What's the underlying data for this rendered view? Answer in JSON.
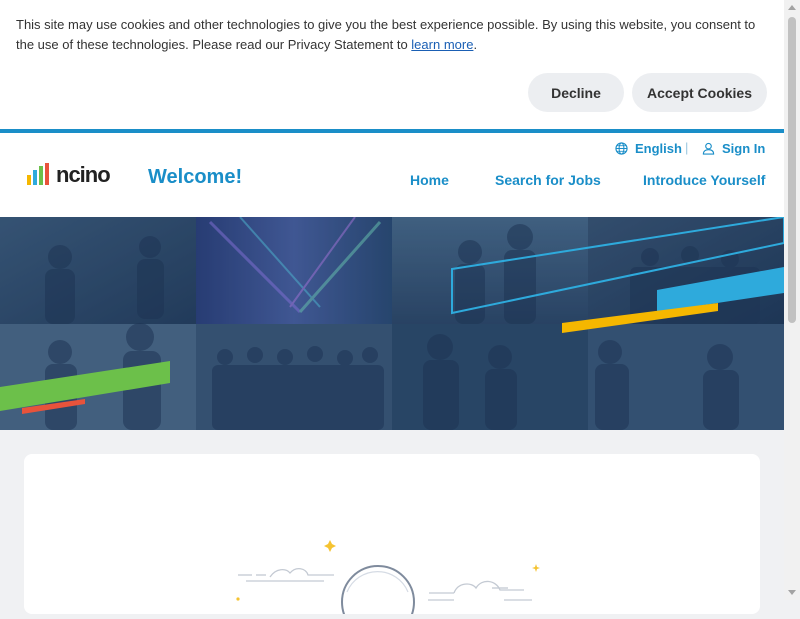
{
  "cookie_banner": {
    "text": "This site may use cookies and other technologies to give you the best experience possible. By using this website, you consent to the use of these technologies. Please read our Privacy Statement to ",
    "link_text": "learn more",
    "text_end": ".",
    "decline_label": "Decline",
    "accept_label": "Accept Cookies"
  },
  "header": {
    "language": "English",
    "separator": "|",
    "sign_in": "Sign In",
    "logo_text": "ncino",
    "welcome": "Welcome!",
    "nav": [
      {
        "label": "Home"
      },
      {
        "label": "Search for Jobs"
      },
      {
        "label": "Introduce Yourself"
      }
    ]
  },
  "colors": {
    "accent_blue": "#1a8ec8",
    "logo_bars": [
      "#f5b700",
      "#2eaadc",
      "#6cc04a",
      "#e8533b"
    ]
  },
  "icons": {
    "language": "globe-icon",
    "sign_in": "user-icon"
  }
}
